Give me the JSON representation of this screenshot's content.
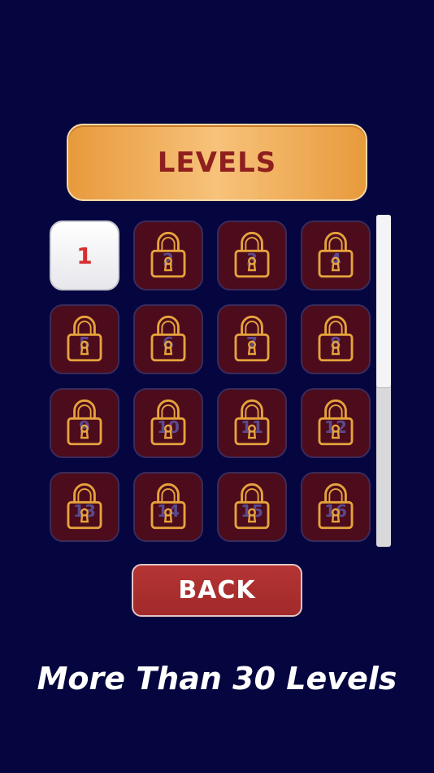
{
  "title": "LEVELS",
  "back_label": "BACK",
  "footer_text": "More Than 30 Levels",
  "colors": {
    "background": "#05063f",
    "banner": "#f0a850",
    "title_text": "#8f1e1e",
    "locked_tile": "#4c0c1c",
    "lock_outline": "#e6a33c",
    "back_button": "#a82e2e",
    "unlocked_number": "#d62f2f"
  },
  "levels": [
    {
      "number": "1",
      "locked": false
    },
    {
      "number": "2",
      "locked": true
    },
    {
      "number": "3",
      "locked": true
    },
    {
      "number": "4",
      "locked": true
    },
    {
      "number": "5",
      "locked": true
    },
    {
      "number": "6",
      "locked": true
    },
    {
      "number": "7",
      "locked": true
    },
    {
      "number": "8",
      "locked": true
    },
    {
      "number": "9",
      "locked": true
    },
    {
      "number": "10",
      "locked": true
    },
    {
      "number": "11",
      "locked": true
    },
    {
      "number": "12",
      "locked": true
    },
    {
      "number": "13",
      "locked": true
    },
    {
      "number": "14",
      "locked": true
    },
    {
      "number": "15",
      "locked": true
    },
    {
      "number": "16",
      "locked": true
    }
  ],
  "scrollbar": {
    "position": 0
  }
}
